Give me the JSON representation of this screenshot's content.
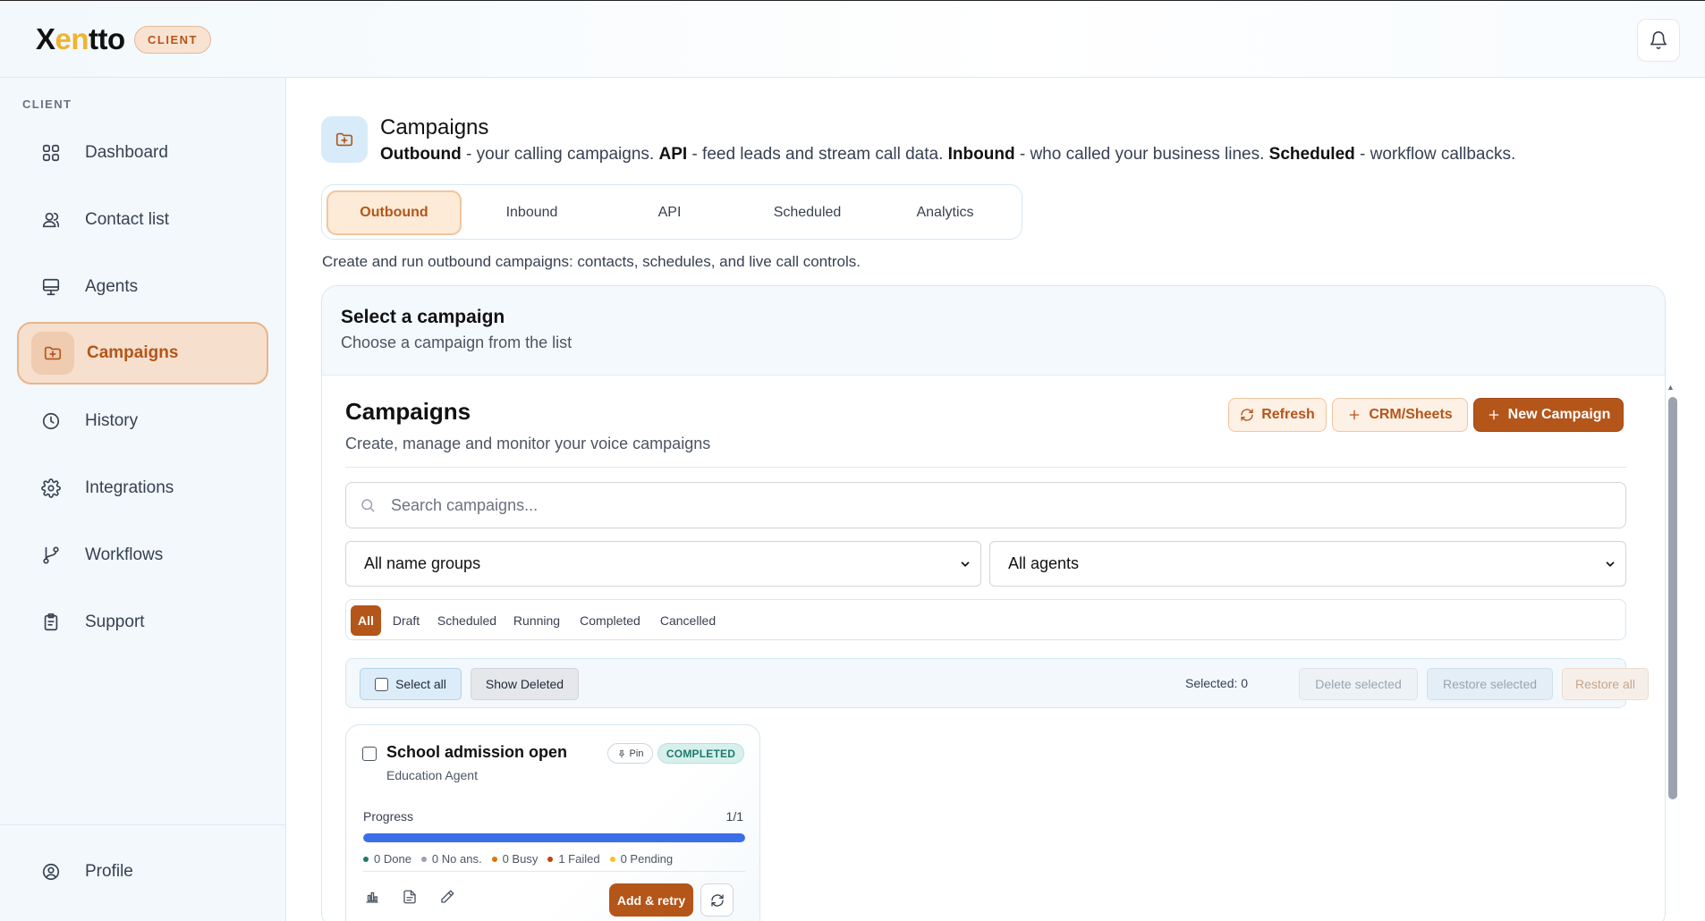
{
  "app": {
    "logo_pre": "X",
    "logo_accent": "en",
    "logo_post": "tto",
    "role_badge": "CLIENT",
    "accent_color": "#b4551a"
  },
  "sidebar": {
    "heading": "CLIENT",
    "items": [
      {
        "label": "Dashboard",
        "icon": "grid-icon"
      },
      {
        "label": "Contact list",
        "icon": "users-icon"
      },
      {
        "label": "Agents",
        "icon": "monitor-icon"
      },
      {
        "label": "Campaigns",
        "icon": "folder-plus-icon",
        "active": true
      },
      {
        "label": "History",
        "icon": "clock-icon"
      },
      {
        "label": "Integrations",
        "icon": "gear-icon"
      },
      {
        "label": "Workflows",
        "icon": "git-branch-icon"
      },
      {
        "label": "Support",
        "icon": "clipboard-icon"
      }
    ],
    "profile_label": "Profile"
  },
  "header": {
    "title": "Campaigns",
    "desc_outbound": "Outbound",
    "desc_outbound_text": " - your calling campaigns. ",
    "desc_api": "API",
    "desc_api_text": " - feed leads and stream call data. ",
    "desc_inbound": "Inbound",
    "desc_inbound_text": " - who called your business lines. ",
    "desc_scheduled": "Scheduled",
    "desc_scheduled_text": " - workflow callbacks."
  },
  "tabs": {
    "items": [
      "Outbound",
      "Inbound",
      "API",
      "Scheduled",
      "Analytics"
    ],
    "active": "Outbound",
    "description": "Create and run outbound campaigns: contacts, schedules, and live call controls."
  },
  "panel": {
    "title": "Select a campaign",
    "subtitle": "Choose a campaign from the list"
  },
  "campaigns": {
    "title": "Campaigns",
    "subtitle": "Create, manage and monitor your voice campaigns",
    "refresh_label": "Refresh",
    "crm_label": "CRM/Sheets",
    "new_label": "New Campaign",
    "search_placeholder": "Search campaigns...",
    "name_group_filter": "All name groups",
    "agent_filter": "All agents",
    "status_filters": [
      "All",
      "Draft",
      "Scheduled",
      "Running",
      "Completed",
      "Cancelled"
    ],
    "active_status_filter": "All",
    "bulk": {
      "select_all": "Select all",
      "show_deleted": "Show Deleted",
      "selected_count": "Selected: 0",
      "delete_selected": "Delete selected",
      "restore_selected": "Restore selected",
      "restore_all": "Restore all"
    },
    "cards": [
      {
        "name": "School admission open",
        "agent": "Education Agent",
        "pin_label": "Pin",
        "status": "COMPLETED",
        "progress_label": "Progress",
        "progress_text": "1/1",
        "progress_fraction": 1.0,
        "stats": [
          {
            "text": "0 Done",
            "color": "#1c7a6a"
          },
          {
            "text": "0 No ans.",
            "color": "#9ca3af"
          },
          {
            "text": "0 Busy",
            "color": "#d97706"
          },
          {
            "text": "1 Failed",
            "color": "#c2410c"
          },
          {
            "text": "0 Pending",
            "color": "#fbbf24"
          }
        ],
        "retry_label": "Add & retry"
      }
    ]
  }
}
